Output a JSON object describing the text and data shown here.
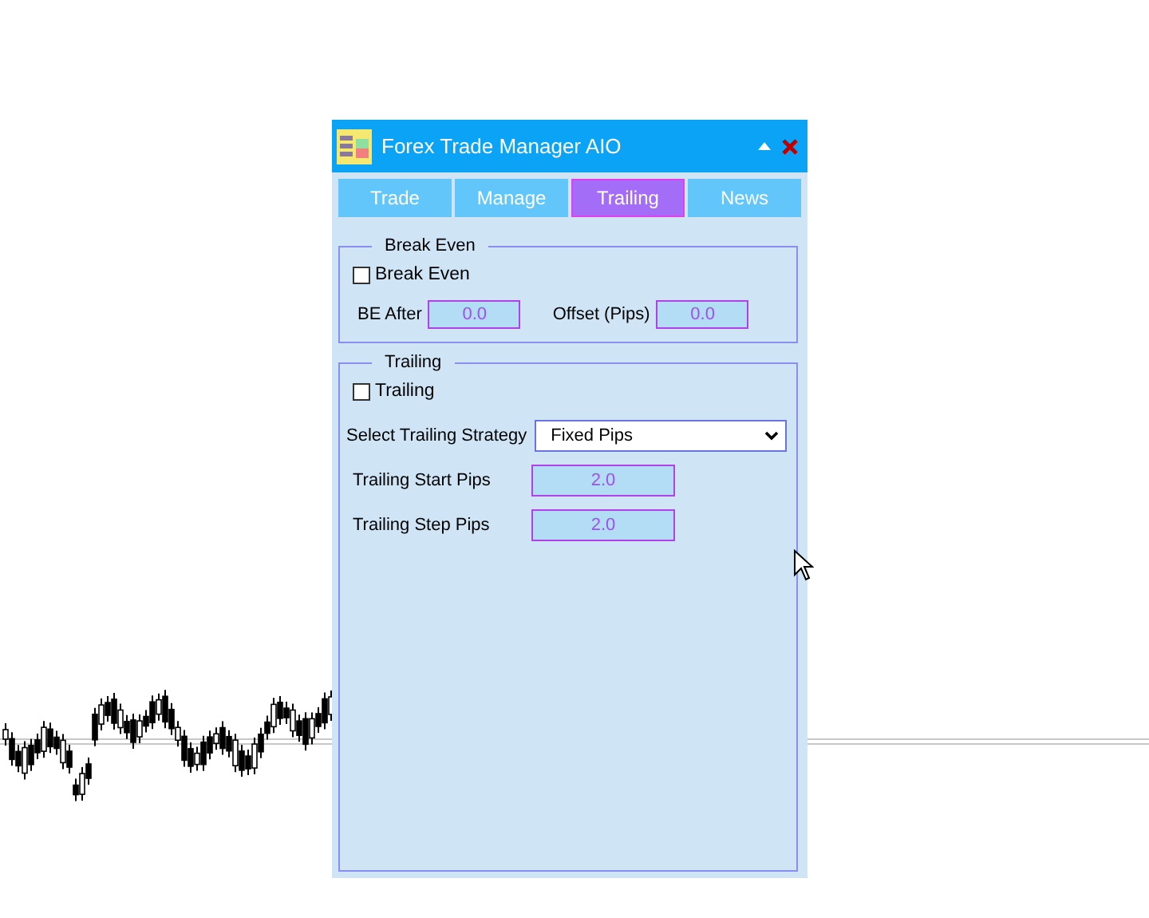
{
  "window": {
    "title": "Forex Trade Manager AIO"
  },
  "tabs": [
    {
      "label": "Trade",
      "selected": false
    },
    {
      "label": "Manage",
      "selected": false
    },
    {
      "label": "Trailing",
      "selected": true
    },
    {
      "label": "News",
      "selected": false
    }
  ],
  "break_even": {
    "title": "Break Even",
    "checkbox": {
      "label": "Break Even",
      "checked": false
    },
    "fields": [
      {
        "label": "BE After",
        "value": "0.0"
      },
      {
        "label": "Offset (Pips)",
        "value": "0.0"
      }
    ]
  },
  "trailing": {
    "title": "Trailing",
    "checkbox": {
      "label": "Trailing",
      "checked": false
    },
    "strategy": {
      "label": "Select Trailing Strategy",
      "value": "Fixed Pips"
    },
    "fields": [
      {
        "label": "Trailing Start Pips",
        "value": "2.0"
      },
      {
        "label": "Trailing Step Pips",
        "value": "2.0"
      }
    ]
  }
}
